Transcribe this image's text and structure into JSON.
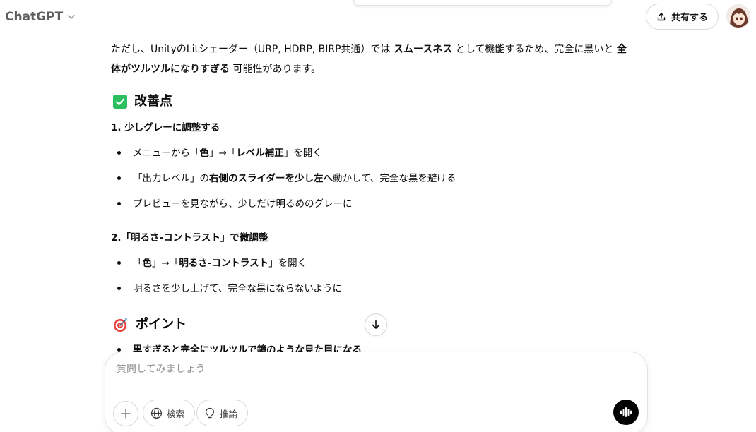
{
  "header": {
    "model_name": "ChatGPT",
    "share_label": "共有する"
  },
  "message": {
    "intro": {
      "t1": "ただし、UnityのLitシェーダー（URP, HDRP, BIRP共通）では ",
      "b1": "スムースネス",
      "t2": " として機能するため、完全に黒いと ",
      "b2": "全体がツルツルになりすぎる",
      "t3": " 可能性があります。"
    },
    "section1": {
      "title": "改善点",
      "step1": {
        "heading": "1. 少しグレーに調整する",
        "bullets": [
          {
            "t1": "メニューから「",
            "b1": "色",
            "t2": "」→「",
            "b2": "レベル補正",
            "t3": "」を開く"
          },
          {
            "t1": "「出力レベル」の ",
            "b1": "右側のスライダーを少し左へ",
            "t2": " 動かして、完全な黒を避ける"
          },
          {
            "t1": "プレビューを見ながら、少しだけ明るめのグレーに"
          }
        ]
      },
      "step2": {
        "heading": "2.「明るさ-コントラスト」で微調整",
        "bullets": [
          {
            "t1": "「",
            "b1": "色",
            "t2": "」→「",
            "b2": "明るさ-コントラスト",
            "t3": "」を開く"
          },
          {
            "t1": "明るさを少し上げて、完全な黒にならないように"
          }
        ]
      }
    },
    "section2": {
      "title": "ポイント",
      "cut_bullet": "黒すぎると完全にツルツルで鏡のような見た目になる"
    }
  },
  "composer": {
    "placeholder": "質問してみましょう",
    "search_label": "検索",
    "reason_label": "推論"
  },
  "icons": {
    "model_chevron": "chevron-down-icon",
    "share": "share-icon",
    "section1": "check-square-icon",
    "section2": "target-dart-icon",
    "scroll": "arrow-down-icon",
    "attach": "plus-icon",
    "search": "globe-icon",
    "reason": "lightbulb-icon",
    "voice": "voice-waveform-icon"
  },
  "colors": {
    "check_green": "#2bbf5f",
    "text": "#0d0d0d",
    "muted": "#5d5d5d"
  }
}
